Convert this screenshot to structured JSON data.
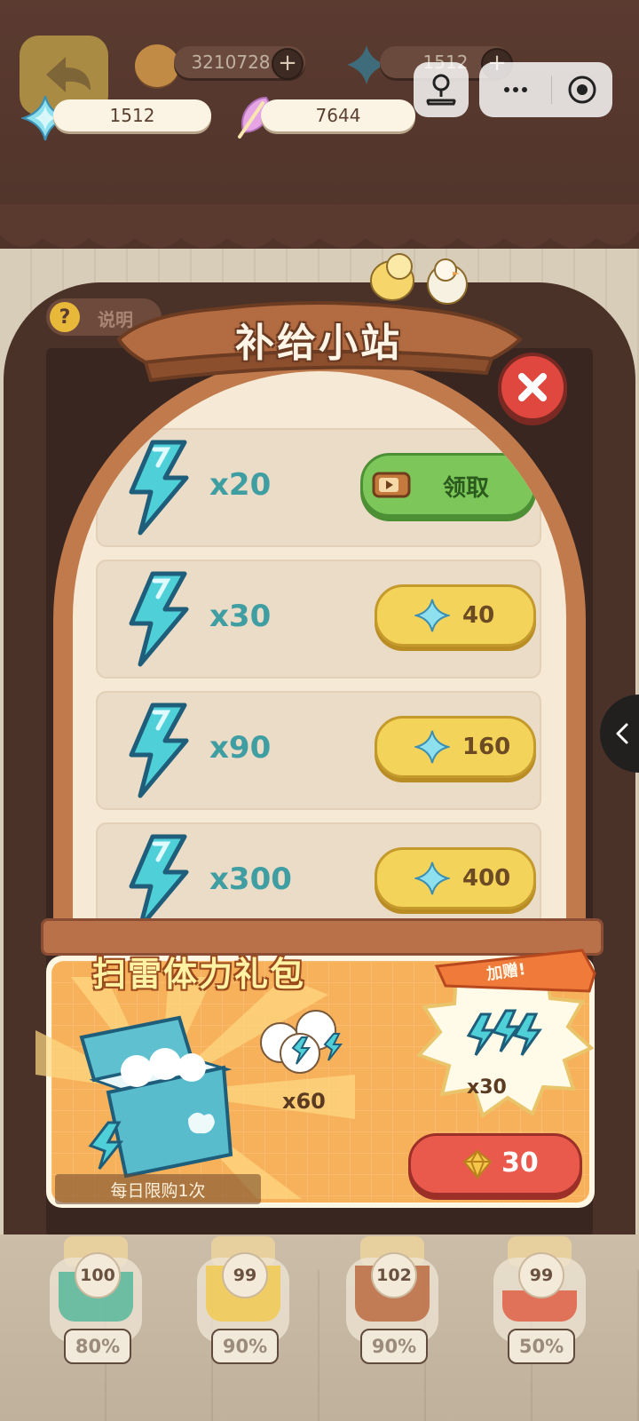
{
  "resources": {
    "paw_coins": "3210728",
    "diamonds_dim": "1512",
    "diamonds": "1512",
    "feathers": "7644"
  },
  "panel": {
    "title": "补给小站",
    "items": [
      {
        "qty": "x20",
        "button_label": "领取",
        "button_type": "video"
      },
      {
        "qty": "x30",
        "price": "40",
        "button_type": "gem"
      },
      {
        "qty": "x90",
        "price": "160",
        "button_type": "gem"
      },
      {
        "qty": "x300",
        "price": "400",
        "button_type": "gem"
      }
    ]
  },
  "help": {
    "label": "说明"
  },
  "gift_pack": {
    "title": "扫雷体力礼包",
    "bags_qty": "x60",
    "bonus_label": "加赠!",
    "bonus_qty": "x30",
    "daily_limit": "每日限购1次",
    "price": "30"
  },
  "jars": [
    {
      "count": "100",
      "percent": "80%",
      "fill_fraction": 0.8,
      "color": "#4fb59a"
    },
    {
      "count": "99",
      "percent": "90%",
      "fill_fraction": 0.9,
      "color": "#f2c84b"
    },
    {
      "count": "102",
      "percent": "90%",
      "fill_fraction": 0.9,
      "color": "#b8643a"
    },
    {
      "count": "99",
      "percent": "50%",
      "fill_fraction": 0.5,
      "color": "#e0573f"
    }
  ],
  "colors": {
    "energy": "#4fd0d8",
    "qty_text": "#3f9ea2",
    "wood": "#c07a4c",
    "cream": "#f6ead6"
  },
  "icons": [
    "back-arrow-icon",
    "paw-coin-icon",
    "diamond-icon",
    "feather-icon",
    "joystick-icon",
    "more-icon",
    "target-icon",
    "lightning-icon",
    "video-icon",
    "close-icon",
    "chevron-left-icon"
  ]
}
